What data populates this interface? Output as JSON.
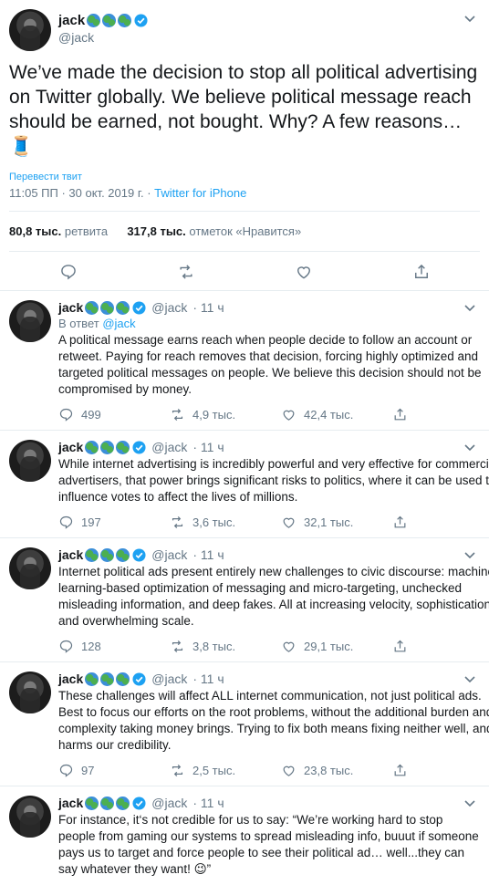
{
  "main_tweet": {
    "name": "jack",
    "handle": "@jack",
    "text": "We’ve made the decision to stop all political advertising on Twitter globally. We believe political message reach should be earned, not bought. Why? A few reasons…🧵",
    "translate_label": "Перевести твит",
    "time": "11:05 ПП · 30 окт. 2019 г.",
    "separator": " · ",
    "source": "Twitter for iPhone",
    "retweets_count": "80,8 тыс.",
    "retweets_label": "ретвита",
    "likes_count": "317,8 тыс.",
    "likes_label": "отметок «Нравится»"
  },
  "replies": [
    {
      "name": "jack",
      "handle": "@jack",
      "time": "· 11 ч",
      "in_reply_prefix": "В ответ",
      "in_reply_to": "@jack",
      "text": "A political message earns reach when people decide to follow an account or retweet. Paying for reach removes that decision, forcing highly optimized and targeted political messages on people. We believe this decision should not be compromised by money.",
      "replies": "499",
      "retweets": "4,9 тыс.",
      "likes": "42,4 тыс."
    },
    {
      "name": "jack",
      "handle": "@jack",
      "time": "· 11 ч",
      "text": "While internet advertising is incredibly powerful and very effective for commercial advertisers, that power brings significant risks to politics, where it can be used to influence votes to affect the lives of millions.",
      "replies": "197",
      "retweets": "3,6 тыс.",
      "likes": "32,1 тыс."
    },
    {
      "name": "jack",
      "handle": "@jack",
      "time": "· 11 ч",
      "text": "Internet political ads present entirely new challenges to civic discourse: machine learning-based optimization of messaging and micro-targeting, unchecked misleading information, and deep fakes. All at increasing velocity, sophistication, and overwhelming scale.",
      "replies": "128",
      "retweets": "3,8 тыс.",
      "likes": "29,1 тыс."
    },
    {
      "name": "jack",
      "handle": "@jack",
      "time": "· 11 ч",
      "text": "These challenges will affect ALL internet communication, not just political ads. Best to focus our efforts on the root problems, without the additional burden and complexity taking money brings. Trying to fix both means fixing neither well, and harms our credibility.",
      "replies": "97",
      "retweets": "2,5 тыс.",
      "likes": "23,8 тыс."
    },
    {
      "name": "jack",
      "handle": "@jack",
      "time": "· 11 ч",
      "text": "For instance, it‘s not credible for us to say: “We’re working hard to stop people from gaming our systems to spread misleading info, buuut if someone pays us to target and force people to see their political ad… well...they can say whatever they want! 😉”"
    }
  ],
  "icons": {
    "name_emojis": [
      "earth-africa-icon",
      "earth-americas-icon",
      "earth-asia-icon",
      "verified-badge-icon"
    ],
    "thread_emoji": "thread-spool-icon",
    "brand_color": "#1da1f2"
  }
}
